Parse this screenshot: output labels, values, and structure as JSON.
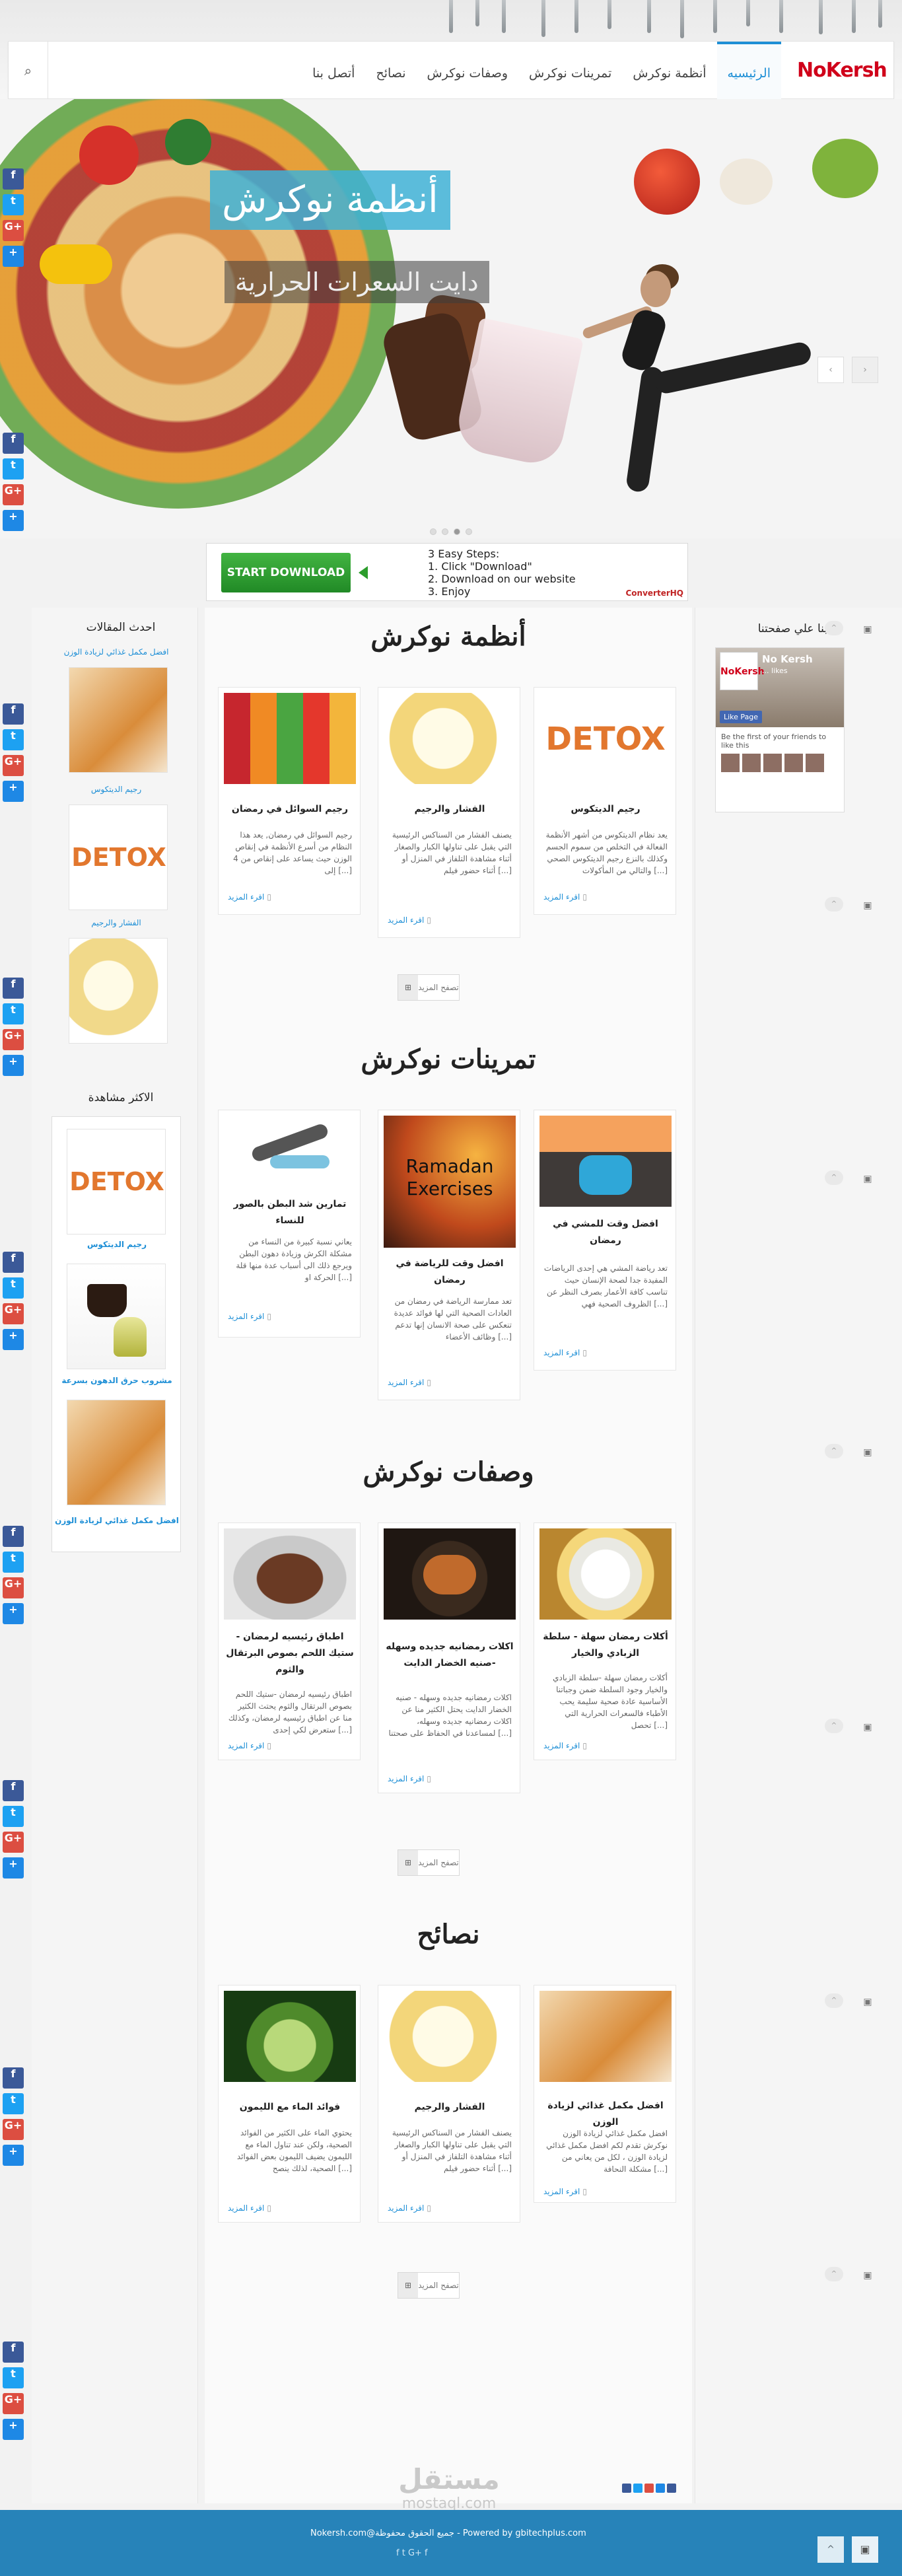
{
  "header": {
    "logo_text": "NoKersh",
    "nav": [
      "الرئيسيه",
      "أنظمة نوكرش",
      "تمرينات نوكرش",
      "وصفات نوكرش",
      "نصائح",
      "أتصل بنا"
    ],
    "search_icon": "search-icon"
  },
  "hero": {
    "title": "أنظمة نوكرش",
    "subtitle": "دايت السعرات الحرارية",
    "prev_glyph": "‹",
    "next_glyph": "›"
  },
  "ad": {
    "button": "START DOWNLOAD",
    "line0": "3 Easy Steps:",
    "line1": "1. Click \"Download\"",
    "line2": "2. Download on our website",
    "line3": "3. Enjoy",
    "brand": "ConverterHQ"
  },
  "share": {
    "fb": "f",
    "tw": "t",
    "gp": "G+",
    "add": "+"
  },
  "right_sidebar": {
    "title": "بنا علي صفحتنا",
    "fb_page_name": "No Kersh",
    "fb_count": "... likes",
    "fb_like": "Like Page",
    "fb_note": "Be the first of your friends to like this"
  },
  "left_sidebar": {
    "recent_title": "احدث المقالات",
    "recent_top_link": "افضل مكمل غذائي لزيادة الوزن",
    "recent_items": [
      "رجيم الديتكوس",
      "الفشار والرجيم"
    ],
    "mostviewed_title": "الاكثر مشاهدة",
    "mostviewed_items": [
      "رجيم الديتكوس",
      "مشروب حرق الدهون بسرعة",
      "افضل مكمل غذائي لزيادة الوزن"
    ]
  },
  "sections": [
    {
      "title": "أنظمة نوكرش",
      "cards": [
        {
          "title": "رجيم الديتكوس",
          "desc": "يعد نظام الديتكوس من أشهر الأنظمة الفعالة في التخلص من سموم الجسم وكذلك بالنزع رجيم الديتكوس الصحي والتالي من المأكولات [...]",
          "more": "اقرء المزيد"
        },
        {
          "title": "الفشار والرجيم",
          "desc": "يصنف الفشار من السناكس الرئيسية التي يقبل على تناولها الكبار والصغار أثناء مشاهدة التلفاز في المنزل أو أثناء حضور فيلم [...]",
          "more": "اقرء المزيد"
        },
        {
          "title": "رجيم السوائل في رمضان",
          "desc": "رجيم السوائل في رمضان, يعد هذا النظام من أسرع الأنظمة في إنقاص الوزن حيث يساعد على إنقاص من 4 إلى [...]",
          "more": "اقرء المزيد"
        }
      ],
      "load_more": "تصفح المزيد"
    },
    {
      "title": "تمرينات نوكرش",
      "cards": [
        {
          "title": "افضل وقت للمشي في رمضان",
          "desc": "تعد رياضة المشي هي إحدى الرياضات المفيدة جدا لصحة الإنسان حيث تناسب كافة الأعمار بصرف النظر عن الظروف الصحية فهي [...]",
          "more": "اقرء المزيد"
        },
        {
          "title": "افضل وقت للرياضة في رمضان",
          "desc": "تعد ممارسة الرياضة في رمضان من العادات الصحية التي لها فوائد عديدة تنعكس على صحة الانسان إنها تدعم وظائف الأعضاء [...]",
          "more": "اقرء المزيد",
          "img_text": "Ramadan Exercises"
        },
        {
          "title": "تمارين شد البطن بالصور للنساء",
          "desc": "يعاني نسبة كبيرة من النساء من مشكلة الكرش وزيادة دهون البطن ويرجع ذلك الى أسباب عدة منها قلة الحركة او [...]",
          "more": "اقرء المزيد"
        }
      ]
    },
    {
      "title": "وصفات نوكرش",
      "cards": [
        {
          "title": "أكلات رمضان سهلة - سلطة الزبادي والخيار",
          "desc": "أكلات رمضان سهلة -سلطة الزبادي والخيار وجود السلطة ضمن وجباتنا الأساسية عادة صحية سليمة يحب الأطباء فالسعرات الحرارية التي تحصل [...]",
          "more": "اقرء المزيد"
        },
        {
          "title": "اكلات رمضانيه جديده وسهله -صنيه الخضار الدايت",
          "desc": "اكلات رمضانيه جديده وسهله - صنيه الخضار الدايت يحتل الكثير منا عن اكلات رمضانيه جديده وسهله، لمساعدنا في الحفاظ على صحتنا [...]",
          "more": "اقرء المزيد"
        },
        {
          "title": "اطباق رئيسيه لرمضان - ستيك اللحم بصوص البرتقال والثوم",
          "desc": "اطباق رئيسيه لرمضان -ستيك اللحم بصوص البرتقال والثوم يحتث الكثير منا عن اطباق رئيسيه لرمضان، وكذلك ستعرض لكي إحدى [...]",
          "more": "اقرء المزيد"
        }
      ],
      "load_more": "تصفح المزيد"
    },
    {
      "title": "نصائح",
      "cards": [
        {
          "title": "افضل مكمل غذائي لزيادة الوزن",
          "desc": "افضل مكمل غذائي لزيادة الوزن نوكرش تقدم لكم افضل مكمل غذائي لزيادة الوزن ، لكل من يعاني من مشكلة النحافة [...]",
          "more": "اقرء المزيد"
        },
        {
          "title": "الفشار والرجيم",
          "desc": "يصنف الفشار من السناكس الرئيسية التي يقبل على تناولها الكبار والصغار أثناء مشاهدة التلفاز في المنزل أو أثناء حضور فيلم [...]",
          "more": "اقرء المزيد"
        },
        {
          "title": "فوائد الماء مع الليمون",
          "desc": "يحتوي الماء على الكثير من الفوائد الصحية، ولكن عند تناول الماء مع الليمون يضيف الليمون بعض الفوائد الصحية، لذلك ينصح [...]",
          "more": "اقرء المزيد"
        }
      ],
      "load_more": "تصفح المزيد"
    }
  ],
  "footer": {
    "copyright": "Nokersh.com@جميع الحقوق محفوظة - Powered by gbitechplus.com",
    "social": "f   t   G+   f",
    "up_glyph": "^",
    "chat_glyph": "▣"
  },
  "watermark": {
    "arabic": "مستقل",
    "latin": "mostaql.com"
  },
  "colors": {
    "accent": "#1e8fd6",
    "footer": "#2783b9",
    "facebook": "#3b5998",
    "twitter": "#1da1f2",
    "google": "#dc4e41"
  }
}
